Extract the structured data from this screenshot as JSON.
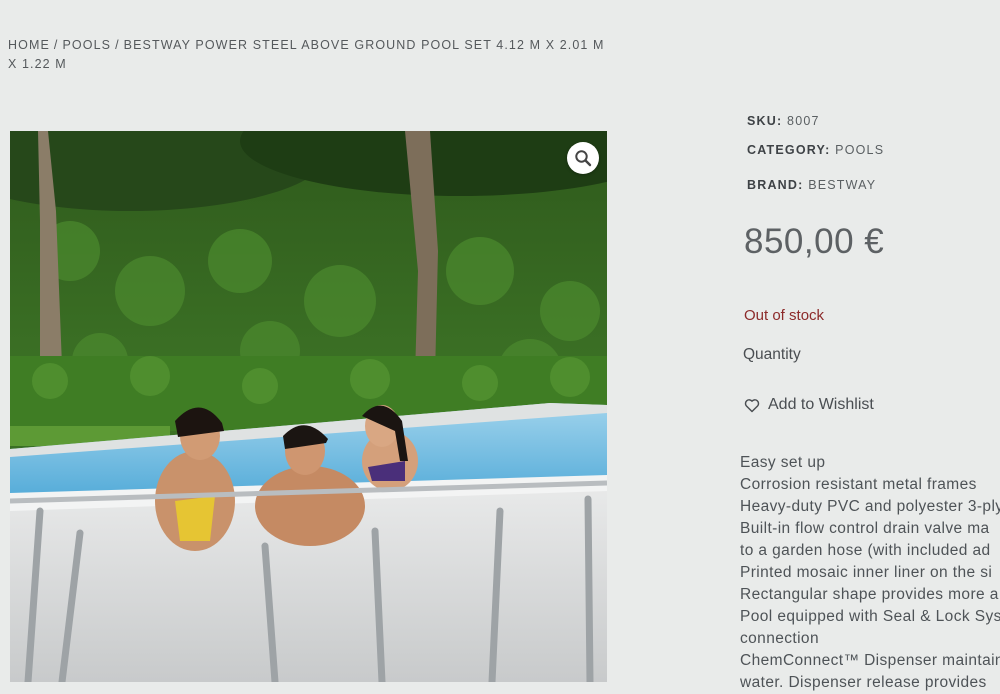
{
  "breadcrumb": {
    "home": "HOME",
    "separator1": "/",
    "category": "POOLS",
    "separator2": "/",
    "current": "BESTWAY POWER STEEL ABOVE GROUND POOL SET 4.12 M X 2.01 M X 1.22 M"
  },
  "product": {
    "image_alt": "Family in above ground pool",
    "zoom_icon": "magnifier-icon",
    "sku_label": "SKU:",
    "sku": "8007",
    "category_label": "CATEGORY:",
    "category": "POOLS",
    "brand_label": "BRAND:",
    "brand": "BESTWAY",
    "price": "850,00 €",
    "stock_status": "Out of stock",
    "quantity_label": "Quantity",
    "wishlist_label": "Add to Wishlist",
    "wishlist_icon": "heart-icon",
    "stock_color": "#8c2a2a"
  },
  "features": [
    "Easy set up",
    "Corrosion resistant metal frames",
    "Heavy-duty PVC and polyester 3-ply",
    "Built-in flow control drain valve ma",
    "to a garden hose (with included ad",
    "Printed mosaic inner liner on the si",
    "Rectangular shape provides more a",
    "Pool equipped with Seal & Lock Sys",
    "connection",
    "ChemConnect™ Dispenser maintain",
    "water. Dispenser release provides"
  ]
}
